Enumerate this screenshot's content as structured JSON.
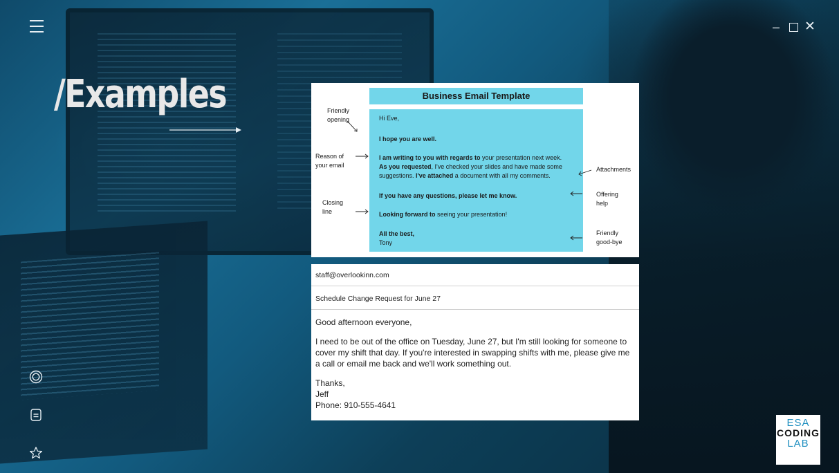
{
  "title": "/Examples",
  "window_controls": {
    "minimize": "–",
    "close": "✕"
  },
  "template": {
    "header": "Business Email Template",
    "lines": [
      {
        "b": "",
        "t": "Hi Eve,"
      },
      {
        "b": "I hope you are well.",
        "t": ""
      },
      {
        "b": "I am writing to you with regards to",
        "t": " your presentation next week."
      },
      {
        "b": "As you requested",
        "t": ", I've checked your slides and have made some"
      },
      {
        "t1": "suggestions. ",
        "b": "I've attached",
        "t": " a document with all my comments."
      },
      {
        "b": "If you have any questions, please let me know.",
        "t": ""
      },
      {
        "b": "Looking forward to",
        "t": " seeing your presentation!"
      },
      {
        "b": "All the best,",
        "t": ""
      },
      {
        "b": "",
        "t": "Tony"
      }
    ],
    "annotations": {
      "friendly_opening_1": "Friendly",
      "friendly_opening_2": "opening",
      "reason_1": "Reason of",
      "reason_2": "your email",
      "closing_1": "Closing",
      "closing_2": "line",
      "attachments": "Attachments",
      "offering_1": "Offering",
      "offering_2": "help",
      "goodbye_1": "Friendly",
      "goodbye_2": "good-bye"
    }
  },
  "email": {
    "to": "staff@overlookinn.com",
    "subject": "Schedule Change Request for June 27",
    "greeting": "Good afternoon everyone,",
    "body_1": "I need to be out of the office on Tuesday, June 27, but I'm still looking for someone to",
    "body_2": "cover my shift that day. If you're interested in swapping shifts with me, please give me",
    "body_3": "a call or email me back and we'll work something out.",
    "sign_1": "Thanks,",
    "sign_2": "Jeff",
    "sign_3": "Phone: 910-555-4641"
  },
  "logo": {
    "line1": "ESA",
    "line2": "CODING",
    "line3": "LAB"
  },
  "icons": {
    "menu": "hamburger-menu-icon",
    "target": "target-icon",
    "document": "document-icon",
    "star": "star-icon"
  },
  "colors": {
    "template_accent": "#72d6ea",
    "logo_blue": "#1f8fc0"
  }
}
